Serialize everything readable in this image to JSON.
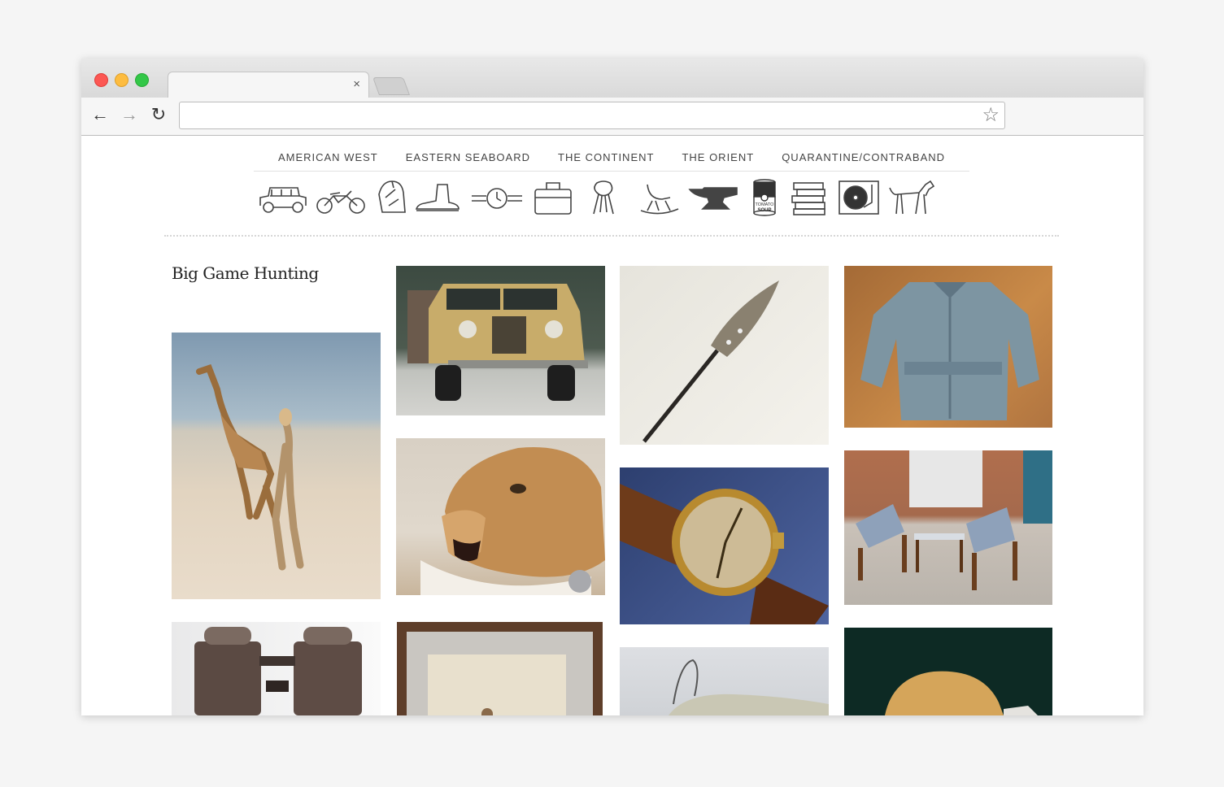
{
  "browser": {
    "close_tab": "×",
    "back": "←",
    "forward": "→",
    "reload": "↻",
    "bookmark": "☆"
  },
  "nav": [
    "AMERICAN WEST",
    "EASTERN SEABOARD",
    "THE CONTINENT",
    "THE ORIENT",
    "QUARANTINE/CONTRABAND"
  ],
  "category_icons": [
    "jeep-icon",
    "motorcycle-icon",
    "backpack-icon",
    "boot-icon",
    "wristwatch-icon",
    "briefcase-icon",
    "scarf-icon",
    "rocking-chair-icon",
    "anvil-icon",
    "soup-can-icon",
    "books-icon",
    "turntable-icon",
    "dog-icon"
  ],
  "soup_can_text": [
    "TOMATO",
    "SOUP"
  ],
  "page_title": "Big Game Hunting",
  "photos": [
    "giraffe-photo",
    "land-rover-photo",
    "spearhead-photo",
    "field-jacket-photo",
    "lion-head-photo",
    "gold-watch-photo",
    "safari-chairs-photo",
    "binoculars-photo",
    "framed-letter-photo",
    "powder-horn-photo",
    "pith-helmet-photo"
  ]
}
